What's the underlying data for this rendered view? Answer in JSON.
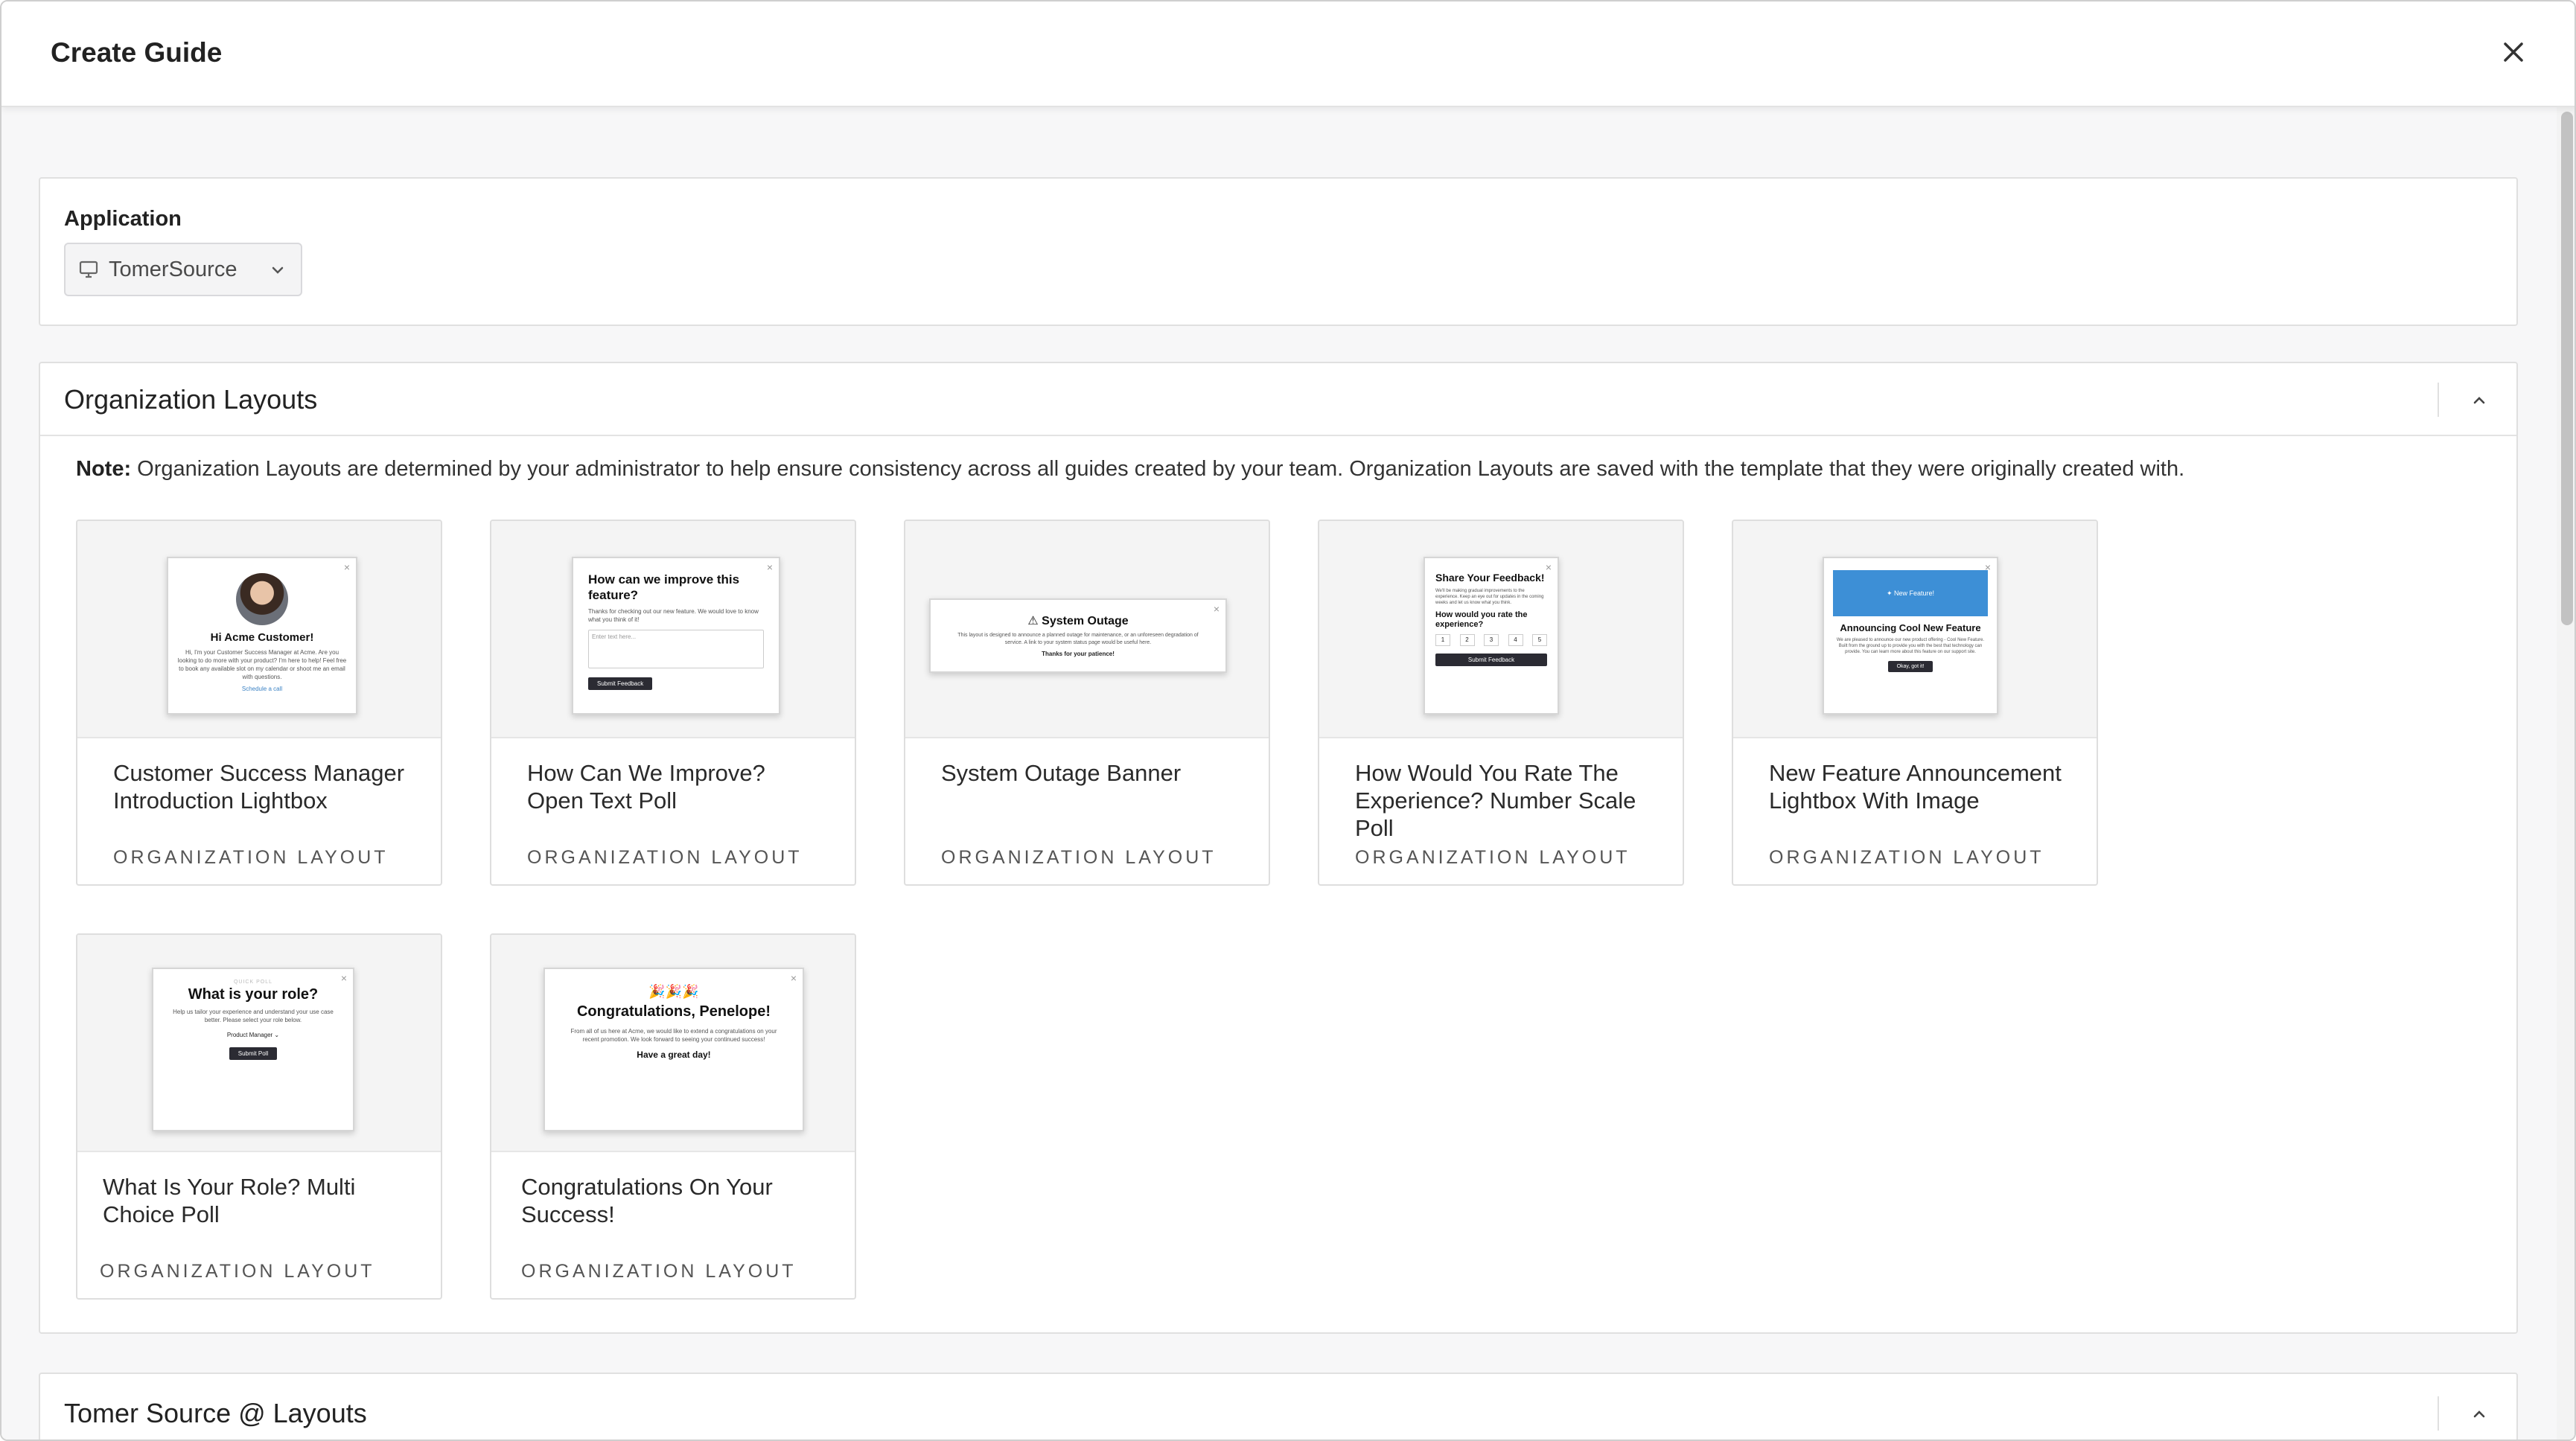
{
  "header": {
    "title": "Create Guide"
  },
  "application": {
    "label": "Application",
    "selected": "TomerSource"
  },
  "org_section": {
    "title": "Organization Layouts",
    "note_label": "Note:",
    "note_text": " Organization Layouts are determined by your administrator to help ensure consistency across all guides created by your team. Organization Layouts are saved with the template that they were originally created with."
  },
  "cards": [
    {
      "name": "Customer Success Manager Introduction Lightbox",
      "type": "ORGANIZATION LAYOUT",
      "preview": {
        "heading": "Hi Acme Customer!",
        "body": "Hi, I'm your Customer Success Manager at Acme. Are you looking to do more with your product? I'm here to help! Feel free to book any available slot on my calendar or shoot me an email with questions.",
        "link": "Schedule a call"
      }
    },
    {
      "name": "How Can We Improve? Open Text Poll",
      "type": "ORGANIZATION LAYOUT",
      "preview": {
        "heading": "How can we improve this feature?",
        "body": "Thanks for checking out our new feature. We would love to know what you think of it!",
        "placeholder": "Enter text here...",
        "button": "Submit Feedback"
      }
    },
    {
      "name": "System Outage Banner",
      "type": "ORGANIZATION LAYOUT",
      "preview": {
        "heading": "⚠ System Outage",
        "body": "This layout is designed to announce a planned outage for maintenance, or an unforeseen degradation of service. A link to your system status page would be useful here.",
        "footer": "Thanks for your patience!"
      }
    },
    {
      "name": "How Would You Rate The Experience? Number Scale Poll",
      "type": "ORGANIZATION LAYOUT",
      "preview": {
        "heading": "Share Your Feedback!",
        "body": "We'll be making gradual improvements to the experience. Keep an eye out for updates in the coming weeks and let us know what you think.",
        "question": "How would you rate the experience?",
        "scale": [
          "1",
          "2",
          "3",
          "4",
          "5"
        ],
        "button": "Submit Feedback"
      }
    },
    {
      "name": "New Feature Announcement Lightbox With Image",
      "type": "ORGANIZATION LAYOUT",
      "preview": {
        "banner": "✦ New Feature!",
        "heading": "Announcing Cool New Feature",
        "body": "We are pleased to announce our new product offering - Cool New Feature. Built from the ground up to provide you with the best that technology can provide. You can learn more about this feature on our support site.",
        "button": "Okay, got it!"
      }
    },
    {
      "name": "What Is Your Role? Multi Choice Poll",
      "type": "ORGANIZATION LAYOUT",
      "preview": {
        "eyebrow": "QUICK POLL",
        "heading": "What is your role?",
        "body": "Help us tailor your experience and understand your use case better. Please select your role below.",
        "select": "Product Manager ⌄",
        "button": "Submit Poll"
      }
    },
    {
      "name": "Congratulations On Your Success!",
      "type": "ORGANIZATION LAYOUT",
      "preview": {
        "emoji": "🎉🎉🎉",
        "heading": "Congratulations, Penelope!",
        "body": "From all of us here at Acme, we would like to extend a congratulations on your recent promotion. We look forward to seeing your continued success!",
        "footer": "Have a great day!"
      }
    }
  ],
  "tomer_section": {
    "title": "Tomer Source @ Layouts"
  }
}
